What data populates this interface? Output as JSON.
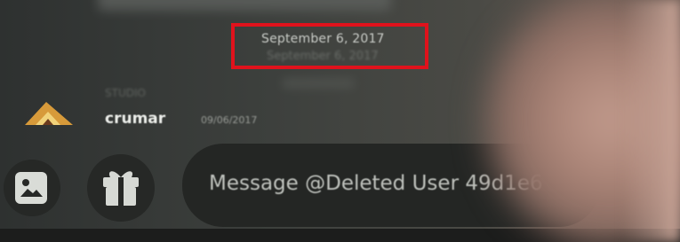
{
  "chat": {
    "date_divider": "September 6, 2017",
    "date_divider_ghost": "September 6, 2017",
    "message": {
      "role": "STUDIO",
      "username": "crumar",
      "timestamp": "09/06/2017"
    }
  },
  "composer": {
    "placeholder": "Message @Deleted User 49d1e6",
    "attach_icon": "image-upload-icon",
    "gift_icon": "gift-icon"
  },
  "colors": {
    "highlight": "#e0121c",
    "background": "#3a3d3b",
    "input_bg": "#242624"
  }
}
